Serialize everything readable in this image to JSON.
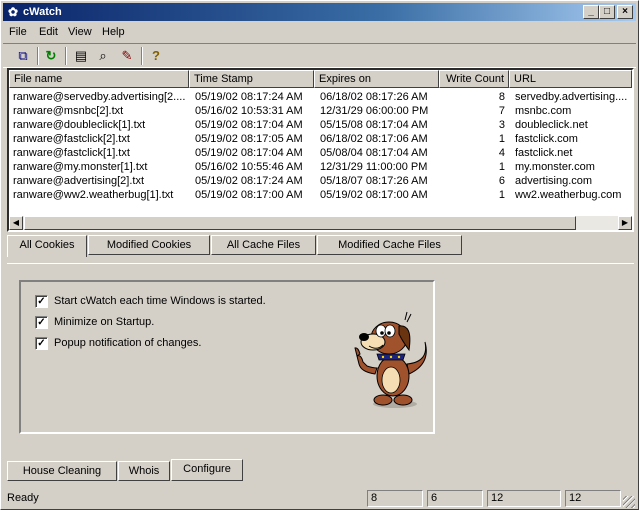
{
  "window": {
    "title": "cWatch",
    "app_icon": "dog-paw-icon",
    "min_glyph": "_",
    "max_glyph": "□",
    "close_glyph": "×"
  },
  "menu": [
    "File",
    "Edit",
    "View",
    "Help"
  ],
  "toolbar": {
    "icons": [
      "copy-icon",
      "refresh-icon",
      "properties-icon",
      "find-icon",
      "tools-icon",
      "help-icon"
    ],
    "glyphs": [
      "⧉",
      "↻",
      "▤",
      "⌕",
      "✎",
      "?"
    ]
  },
  "list": {
    "columns": [
      "File name",
      "Time Stamp",
      "Expires on",
      "Write Count",
      "URL"
    ],
    "rows": [
      [
        "ranware@servedby.advertising[2....",
        "05/19/02 08:17:24 AM",
        "06/18/02 08:17:26 AM",
        "8",
        "servedby.advertising...."
      ],
      [
        "ranware@msnbc[2].txt",
        "05/16/02 10:53:31 AM",
        "12/31/29 06:00:00 PM",
        "7",
        "msnbc.com"
      ],
      [
        "ranware@doubleclick[1].txt",
        "05/19/02 08:17:04 AM",
        "05/15/08 08:17:04 AM",
        "3",
        "doubleclick.net"
      ],
      [
        "ranware@fastclick[2].txt",
        "05/19/02 08:17:05 AM",
        "06/18/02 08:17:06 AM",
        "1",
        "fastclick.com"
      ],
      [
        "ranware@fastclick[1].txt",
        "05/19/02 08:17:04 AM",
        "05/08/04 08:17:04 AM",
        "4",
        "fastclick.net"
      ],
      [
        "ranware@my.monster[1].txt",
        "05/16/02 10:55:46 AM",
        "12/31/29 11:00:00 PM",
        "1",
        "my.monster.com"
      ],
      [
        "ranware@advertising[2].txt",
        "05/19/02 08:17:24 AM",
        "05/18/07 08:17:26 AM",
        "6",
        "advertising.com"
      ],
      [
        "ranware@ww2.weatherbug[1].txt",
        "05/19/02 08:17:00 AM",
        "05/19/02 08:17:00 AM",
        "1",
        "ww2.weatherbug.com"
      ]
    ]
  },
  "upper_tabs": [
    "All Cookies",
    "Modified Cookies",
    "All Cache Files",
    "Modified Cache Files"
  ],
  "upper_tab_active": "All Cookies",
  "options": [
    {
      "label": "Start cWatch each time Windows is started.",
      "checked": true
    },
    {
      "label": "Minimize on Startup.",
      "checked": true
    },
    {
      "label": "Popup notification of changes.",
      "checked": true
    }
  ],
  "check_glyph": "✓",
  "mascot": "cartoon-dog-thumbs-up",
  "lower_tabs": [
    "House Cleaning",
    "Whois",
    "Configure"
  ],
  "lower_tab_active": "Configure",
  "status": {
    "text": "Ready",
    "panes": [
      "8",
      "6",
      "12",
      "12"
    ]
  }
}
